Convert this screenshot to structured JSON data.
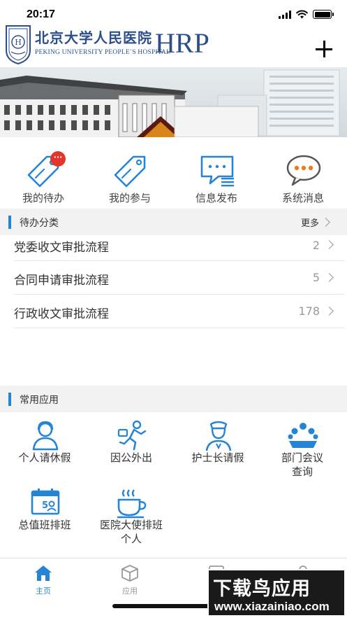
{
  "status_bar": {
    "time": "20:17"
  },
  "header": {
    "logo_cn": "北京大学人民医院",
    "logo_en": "PEKING UNIVERSITY PEOPLE`S HOSPITAL",
    "logo_hrp": "HRP",
    "add_icon": "plus-icon"
  },
  "quick_actions": [
    {
      "label": "我的待办",
      "icon": "tag-icon",
      "badge": "···"
    },
    {
      "label": "我的参与",
      "icon": "tag-icon"
    },
    {
      "label": "信息发布",
      "icon": "message-list-icon"
    },
    {
      "label": "系统消息",
      "icon": "chat-bubble-icon"
    }
  ],
  "todo_section": {
    "title": "待办分类",
    "more_label": "更多",
    "items": [
      {
        "title": "党委收文审批流程",
        "count": "2"
      },
      {
        "title": "合同申请审批流程",
        "count": "5"
      },
      {
        "title": "行政收文审批流程",
        "count": "178"
      }
    ]
  },
  "apps_section": {
    "title": "常用应用",
    "items": [
      {
        "label": "个人请休假",
        "icon": "person-headset-icon"
      },
      {
        "label": "因公外出",
        "icon": "running-man-icon"
      },
      {
        "label": "护士长请假",
        "icon": "nurse-icon"
      },
      {
        "label": "部门会议查询",
        "icon": "meeting-icon"
      },
      {
        "label": "总值班排班",
        "icon": "calendar-person-icon"
      },
      {
        "label": "医院大使排班个人",
        "icon": "coffee-cup-icon"
      }
    ]
  },
  "tabbar": {
    "tabs": [
      {
        "label": "主页",
        "icon": "home-icon",
        "active": true
      },
      {
        "label": "应用",
        "icon": "cube-icon",
        "active": false
      },
      {
        "label": "通",
        "icon": "contacts-icon",
        "active": false
      },
      {
        "label": "",
        "icon": "user-icon",
        "active": false
      }
    ]
  },
  "watermark": {
    "main": "下载鸟应用",
    "sub": "www.xiazainiao.com"
  },
  "colors": {
    "accent": "#2684d7",
    "brand": "#2c4f8c",
    "badge": "#e0362c"
  }
}
